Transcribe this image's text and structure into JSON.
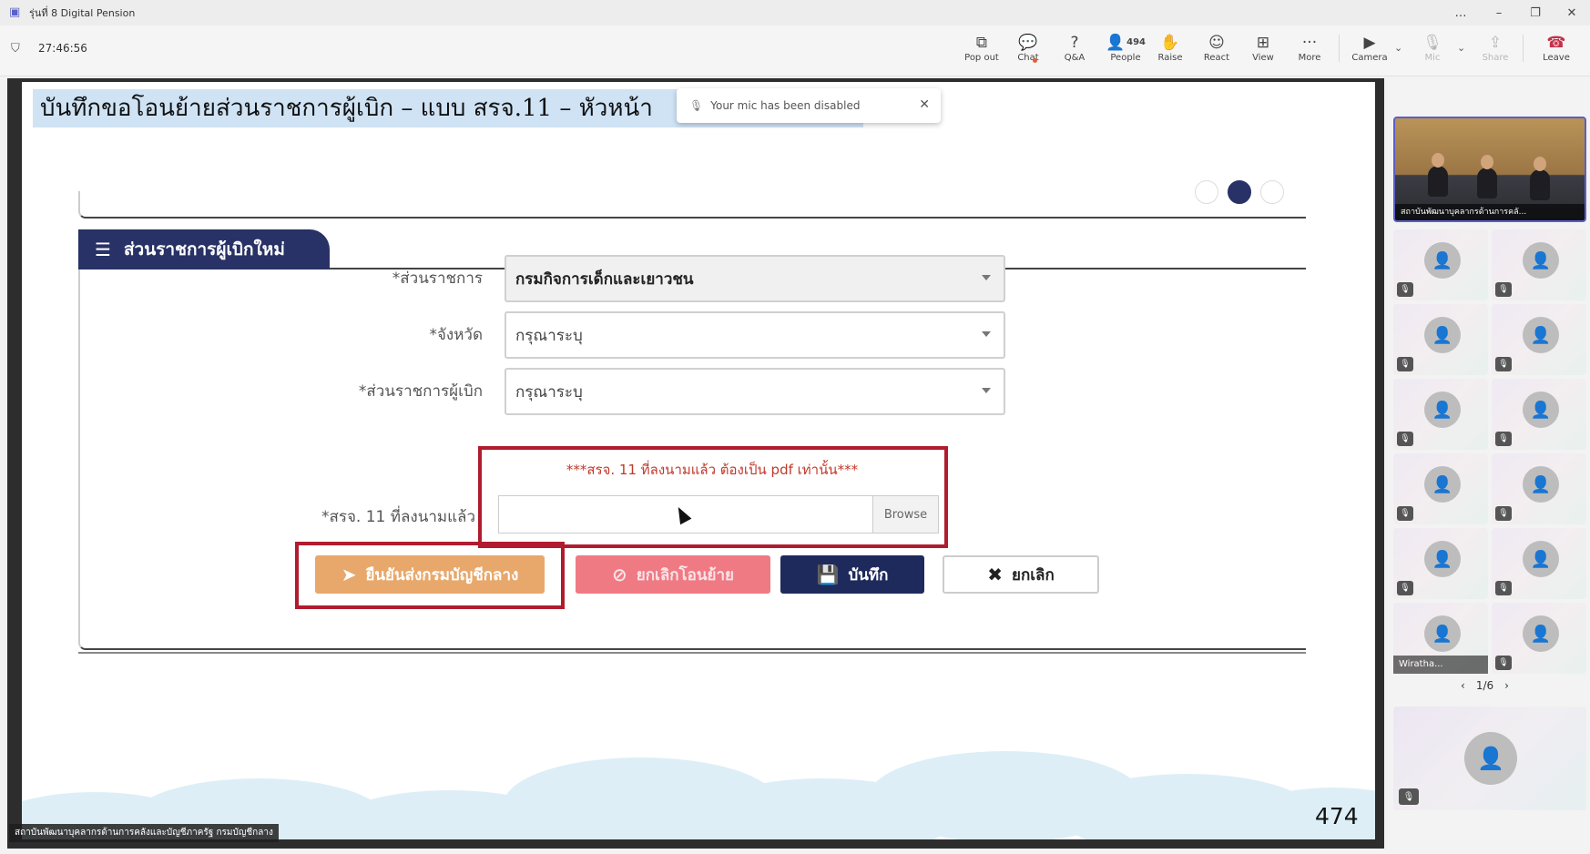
{
  "window": {
    "title": "รุ่นที่ 8 Digital Pension",
    "controls": [
      "…",
      "–",
      "❐",
      "✕"
    ]
  },
  "meeting": {
    "timer": "27:46:56",
    "toolbar": [
      {
        "label": "Pop out",
        "icon": "pop-out-icon",
        "glyph": "⧉"
      },
      {
        "label": "Chat",
        "icon": "chat-icon",
        "glyph": "💬"
      },
      {
        "label": "Q&A",
        "icon": "qa-icon",
        "glyph": "?"
      },
      {
        "label": "People",
        "icon": "people-icon",
        "glyph": "👤",
        "count": "494"
      },
      {
        "label": "Raise",
        "icon": "raise-hand-icon",
        "glyph": "✋"
      },
      {
        "label": "React",
        "icon": "react-icon",
        "glyph": "☺"
      },
      {
        "label": "View",
        "icon": "view-icon",
        "glyph": "⊞"
      },
      {
        "label": "More",
        "icon": "more-icon",
        "glyph": "···"
      },
      {
        "label": "Camera",
        "icon": "camera-off-icon",
        "glyph": "▶"
      },
      {
        "label": "Mic",
        "icon": "mic-icon",
        "glyph": "🎙"
      },
      {
        "label": "Share",
        "icon": "share-icon",
        "glyph": "⇪"
      },
      {
        "label": "Leave",
        "icon": "leave-icon",
        "glyph": "☎"
      }
    ]
  },
  "slide": {
    "title": "บันทึกขอโอนย้ายส่วนราชการผู้เบิก – แบบ สรจ.11 – หัวหน้า",
    "toast": "Your mic has been disabled",
    "section_title": "ส่วนราชการผู้เบิกใหม่",
    "fields": [
      {
        "label": "*ส่วนราชการ",
        "value": "กรมกิจการเด็กและเยาวชน"
      },
      {
        "label": "*จังหวัด",
        "value": "กรุณาระบุ"
      },
      {
        "label": "*ส่วนราชการผู้เบิก",
        "value": "กรุณาระบุ"
      }
    ],
    "note": "***สรจ. 11 ที่ลงนามแล้ว ต้องเป็น pdf เท่านั้น***",
    "file_label": "*สรจ. 11 ที่ลงนามแล้ว",
    "browse": "Browse",
    "buttons": {
      "confirm": "ยืนยันส่งกรมบัญชีกลาง",
      "cancel_move": "ยกเลิกโอนย้าย",
      "save": "บันทึก",
      "cancel": "ยกเลิก"
    },
    "page_number": "474",
    "caption": "สถาบันพัฒนาบุคลากรด้านการคลังและบัญชีภาครัฐ กรมบัญชีกลาง"
  },
  "participants": {
    "speaker_name": "สถาบันพัฒนาบุคลากรด้านการคลั...",
    "named_tile": "Wiratha...",
    "pager": "1/6"
  },
  "colors": {
    "accent": "#5b5fc7",
    "navy": "#283266",
    "confirm": "#e8a86b",
    "cancel_move": "#ef7a84",
    "highlight_box": "#b01c2e",
    "leave": "#c4314b"
  }
}
